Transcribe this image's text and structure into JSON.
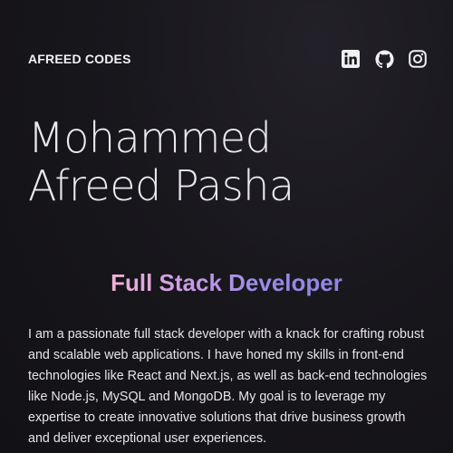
{
  "header": {
    "brand": "AFREED CODES",
    "socials": [
      {
        "icon": "linkedin-icon"
      },
      {
        "icon": "github-icon"
      },
      {
        "icon": "instagram-icon"
      }
    ]
  },
  "hero": {
    "name_line1": "Mohammed",
    "name_line2": "Afreed Pasha",
    "role": "Full Stack Developer",
    "bio": "I am a passionate full stack developer with a knack for crafting robust and scalable web applications. I have honed my skills in front-end technologies like React and Next.js, as well as back-end technologies like Node.js, MySQL and MongoDB. My goal is to leverage my expertise to create innovative solutions that drive business growth and deliver exceptional user experiences."
  },
  "colors": {
    "background": "#18171c",
    "text": "#ececf0",
    "role_gradient_start": "#f0b3d8",
    "role_gradient_end": "#8d86e4"
  }
}
